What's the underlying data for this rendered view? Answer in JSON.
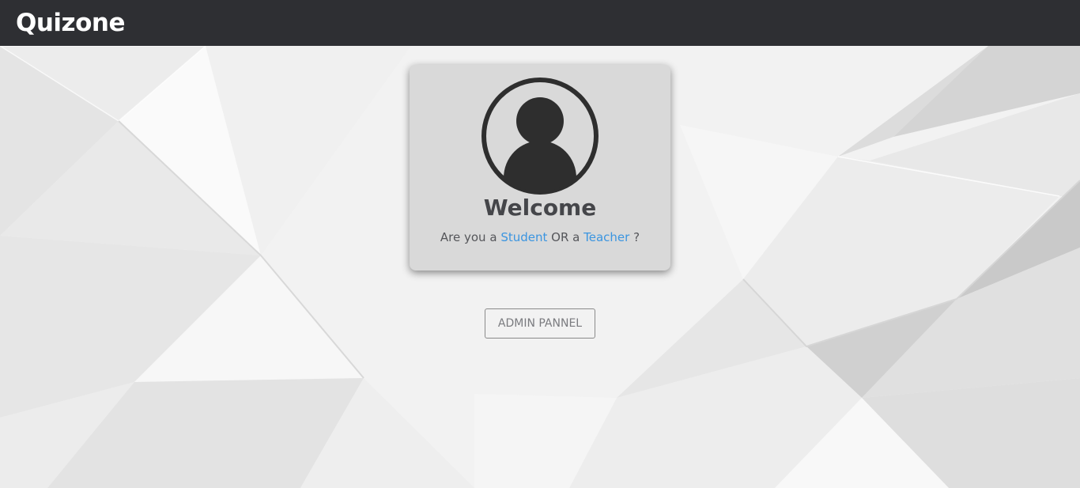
{
  "navbar": {
    "brand": "Quizone"
  },
  "card": {
    "avatar_icon": "user-avatar-icon",
    "title": "Welcome",
    "question_prefix": "Are you a",
    "student_link": "Student",
    "or_text": "OR a",
    "teacher_link": "Teacher",
    "question_suffix": "?"
  },
  "admin_button": {
    "label": "ADMIN PANNEL"
  },
  "colors": {
    "navbar_bg": "#2e2f33",
    "card_bg": "#d9d9d9",
    "link": "#3b95e0",
    "avatar": "#2e2e2e"
  }
}
